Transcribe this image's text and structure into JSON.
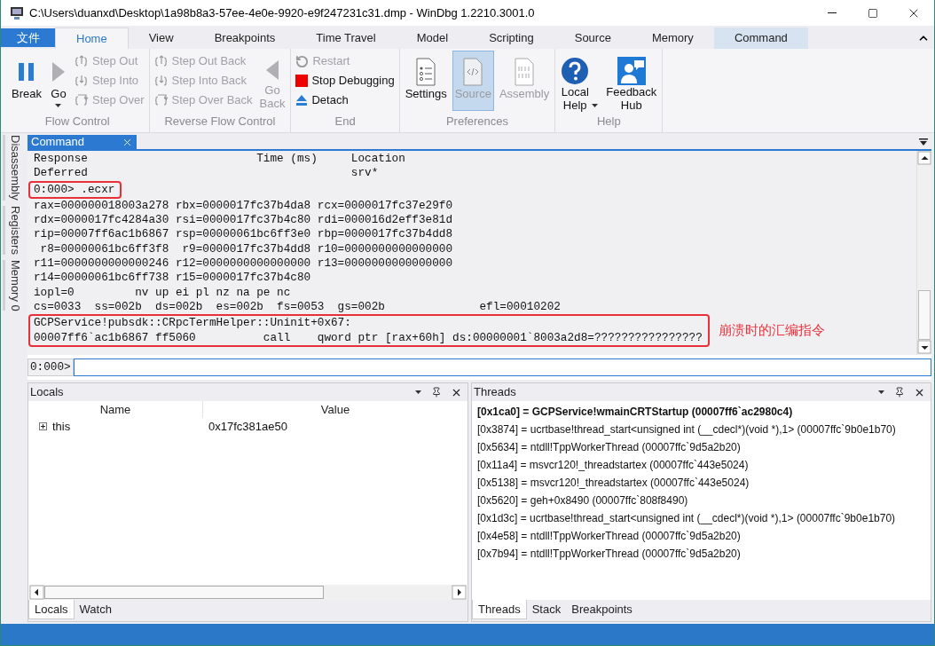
{
  "window": {
    "title": "C:\\Users\\duanxd\\Desktop\\1a98b8a3-57ee-4e0e-9920-e9f247231c31.dmp - WinDbg 1.2210.3001.0"
  },
  "ribbon": {
    "file_tab": "文件",
    "tabs": [
      {
        "label": "Home",
        "selected": true,
        "kind": "normal"
      },
      {
        "label": "View",
        "selected": false,
        "kind": "normal"
      },
      {
        "label": "Breakpoints",
        "selected": false,
        "kind": "normal"
      },
      {
        "label": "Time Travel",
        "selected": false,
        "kind": "normal"
      },
      {
        "label": "Model",
        "selected": false,
        "kind": "normal"
      },
      {
        "label": "Scripting",
        "selected": false,
        "kind": "normal"
      },
      {
        "label": "Source",
        "selected": false,
        "kind": "normal"
      },
      {
        "label": "Memory",
        "selected": false,
        "kind": "normal"
      },
      {
        "label": "Command",
        "selected": false,
        "kind": "contextual"
      }
    ],
    "groups": [
      {
        "label": "Flow Control",
        "items": [
          {
            "label": "Break",
            "kind": "large",
            "disabled": false,
            "dropdown": false
          },
          {
            "label": "Go",
            "kind": "large",
            "disabled": false,
            "dropdown": true
          },
          {
            "label": "Step Out",
            "kind": "small",
            "disabled": true
          },
          {
            "label": "Step Into",
            "kind": "small",
            "disabled": true
          },
          {
            "label": "Step Over",
            "kind": "small",
            "disabled": true
          }
        ]
      },
      {
        "label": "Reverse Flow Control",
        "items": [
          {
            "label": "Step Out Back",
            "kind": "small",
            "disabled": true
          },
          {
            "label": "Step Into Back",
            "kind": "small",
            "disabled": true
          },
          {
            "label": "Step Over Back",
            "kind": "small",
            "disabled": true
          },
          {
            "label": "Go Back",
            "kind": "large",
            "disabled": true,
            "dropdown": false
          }
        ]
      },
      {
        "label": "End",
        "items": [
          {
            "label": "Restart",
            "kind": "small",
            "disabled": true
          },
          {
            "label": "Stop Debugging",
            "kind": "small",
            "disabled": false
          },
          {
            "label": "Detach",
            "kind": "small",
            "disabled": false
          }
        ]
      },
      {
        "label": "Preferences",
        "items": [
          {
            "label": "Settings",
            "kind": "large",
            "disabled": false,
            "dropdown": false,
            "selected": false
          },
          {
            "label": "Source",
            "kind": "large",
            "disabled": false,
            "dropdown": false,
            "selected": true
          },
          {
            "label": "Assembly",
            "kind": "large",
            "disabled": true,
            "dropdown": false,
            "selected": false
          }
        ]
      },
      {
        "label": "Help",
        "items": [
          {
            "label": "Local Help",
            "kind": "large",
            "disabled": false,
            "dropdown": true
          },
          {
            "label": "Feedback Hub",
            "kind": "large",
            "disabled": false,
            "dropdown": false
          }
        ]
      }
    ]
  },
  "side_tabs": [
    "Disassembly",
    "Registers",
    "Memory 0"
  ],
  "command": {
    "tab": "Command",
    "blocks": [
      {
        "boxed": false,
        "lines": [
          "Response                         Time (ms)     Location",
          "Deferred                                       srv*"
        ]
      },
      {
        "boxed": true,
        "lines": [
          "0:000> .ecxr"
        ]
      },
      {
        "boxed": false,
        "lines": [
          "rax=000000018003a278 rbx=0000017fc37b4da8 rcx=0000017fc37e29f0",
          "rdx=0000017fc4284a30 rsi=0000017fc37b4c80 rdi=000016d2eff3e81d",
          "rip=00007ff6ac1b6867 rsp=00000061bc6ff3e0 rbp=0000017fc37b4dd8",
          " r8=00000061bc6ff3f8  r9=0000017fc37b4dd8 r10=0000000000000000",
          "r11=0000000000000246 r12=0000000000000000 r13=0000000000000000",
          "r14=00000061bc6ff738 r15=0000017fc37b4c80",
          "iopl=0         nv up ei pl nz na pe nc",
          "cs=0033  ss=002b  ds=002b  es=002b  fs=0053  gs=002b              efl=00010202"
        ]
      },
      {
        "boxed": true,
        "note": "崩溃时的汇编指令",
        "lines": [
          "GCPService!pubsdk::CRpcTermHelper::Uninit+0x67:",
          "00007ff6`ac1b6867 ff5060          call    qword ptr [rax+60h] ds:00000001`8003a2d8=????????????????"
        ]
      }
    ],
    "prompt": "0:000>"
  },
  "locals": {
    "title": "Locals",
    "columns": [
      "Name",
      "Value"
    ],
    "rows": [
      {
        "name": "this",
        "value": "0x17fc381ae50",
        "expanded": false
      }
    ],
    "tabs": [
      {
        "label": "Locals",
        "selected": true
      },
      {
        "label": "Watch",
        "selected": false
      }
    ]
  },
  "threads": {
    "title": "Threads",
    "items": [
      {
        "text": "[0x1ca0] = GCPService!wmainCRTStartup (00007ff6`ac2980c4)",
        "current": true
      },
      {
        "text": "[0x3874] = ucrtbase!thread_start<unsigned int (__cdecl*)(void *),1> (00007ffc`9b0e1b70)",
        "current": false
      },
      {
        "text": "[0x5634] = ntdll!TppWorkerThread (00007ffc`9d5a2b20)",
        "current": false
      },
      {
        "text": "[0x11a4] = msvcr120!_threadstartex (00007ffc`443e5024)",
        "current": false
      },
      {
        "text": "[0x5138] = msvcr120!_threadstartex (00007ffc`443e5024)",
        "current": false
      },
      {
        "text": "[0x5620] = geh+0x8490 (00007ffc`808f8490)",
        "current": false
      },
      {
        "text": "[0x1d3c] = ucrtbase!thread_start<unsigned int (__cdecl*)(void *),1> (00007ffc`9b0e1b70)",
        "current": false
      },
      {
        "text": "[0x4e58] = ntdll!TppWorkerThread (00007ffc`9d5a2b20)",
        "current": false
      },
      {
        "text": "[0x7b94] = ntdll!TppWorkerThread (00007ffc`9d5a2b20)",
        "current": false
      }
    ],
    "tabs": [
      {
        "label": "Threads",
        "selected": true
      },
      {
        "label": "Stack",
        "selected": false
      },
      {
        "label": "Breakpoints",
        "selected": false
      }
    ]
  }
}
